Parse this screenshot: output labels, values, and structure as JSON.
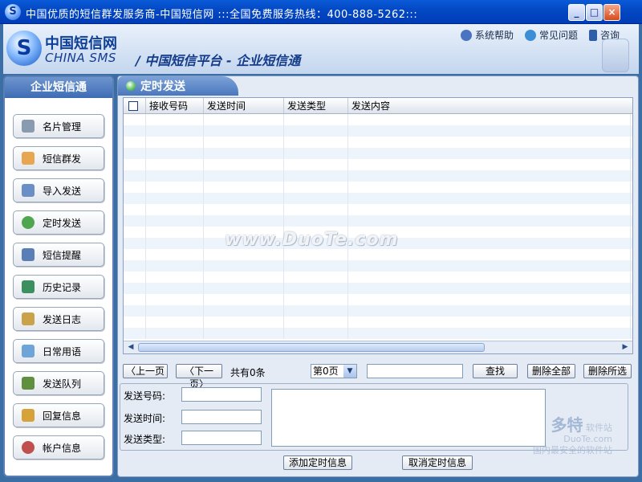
{
  "window": {
    "title": "中国优质的短信群发服务商-中国短信网 :::全国免费服务热线：400-888-5262:::",
    "controls": {
      "minimize": "_",
      "maximize": "□",
      "close": "×"
    },
    "app_icon": "S"
  },
  "header": {
    "logo_cn": "中国短信网",
    "logo_en": "CHINA SMS",
    "slogan": "/ 中国短信平台 - 企业短信通",
    "links": [
      {
        "label": "系统帮助",
        "icon": "help-book-icon",
        "color": "#4a73c2"
      },
      {
        "label": "常见问题",
        "icon": "question-globe-icon",
        "color": "#3c8fd6"
      },
      {
        "label": "咨询",
        "icon": "consult-arrow-icon",
        "color": "#2f5fa8"
      }
    ]
  },
  "sidebar": {
    "title": "企业短信通",
    "items": [
      {
        "label": "名片管理",
        "icon": "card-icon",
        "color": "#8a9bb0"
      },
      {
        "label": "短信群发",
        "icon": "mass-send-icon",
        "color": "#e8a650"
      },
      {
        "label": "导入发送",
        "icon": "import-icon",
        "color": "#6a8fc7"
      },
      {
        "label": "定时发送",
        "icon": "clock-icon",
        "color": "#4ea64e"
      },
      {
        "label": "短信提醒",
        "icon": "reminder-icon",
        "color": "#5a7fb7"
      },
      {
        "label": "历史记录",
        "icon": "history-icon",
        "color": "#3c8f5f"
      },
      {
        "label": "发送日志",
        "icon": "log-icon",
        "color": "#c9a24a"
      },
      {
        "label": "日常用语",
        "icon": "phrase-icon",
        "color": "#6fa4d9"
      },
      {
        "label": "发送队列",
        "icon": "queue-icon",
        "color": "#5f8f3f"
      },
      {
        "label": "回复信息",
        "icon": "reply-icon",
        "color": "#d6a23a"
      },
      {
        "label": "帐户信息",
        "icon": "account-icon",
        "color": "#c0504d"
      }
    ]
  },
  "main": {
    "tab_title": "定时发送",
    "table": {
      "columns": [
        "接收号码",
        "发送时间",
        "发送类型",
        "发送内容"
      ]
    },
    "pager": {
      "prev": "上一页",
      "next": "下一页",
      "total": "共有0条",
      "page_select": "第0页",
      "search_value": "",
      "search_btn": "查找",
      "delete_all": "删除全部",
      "delete_selected": "删除所选"
    },
    "form": {
      "number_label": "发送号码:",
      "time_label": "发送时间:",
      "type_label": "发送类型:",
      "number_value": "",
      "time_value": "",
      "type_value": "",
      "content_value": ""
    },
    "actions": {
      "add": "添加定时信息",
      "cancel": "取消定时信息"
    }
  },
  "watermark": {
    "main": "www.DuoTe.com",
    "corner_big": "多特",
    "corner_sub": "软件站",
    "corner_url": "DuoTe.com",
    "corner_line": "国内最安全的软件站"
  }
}
